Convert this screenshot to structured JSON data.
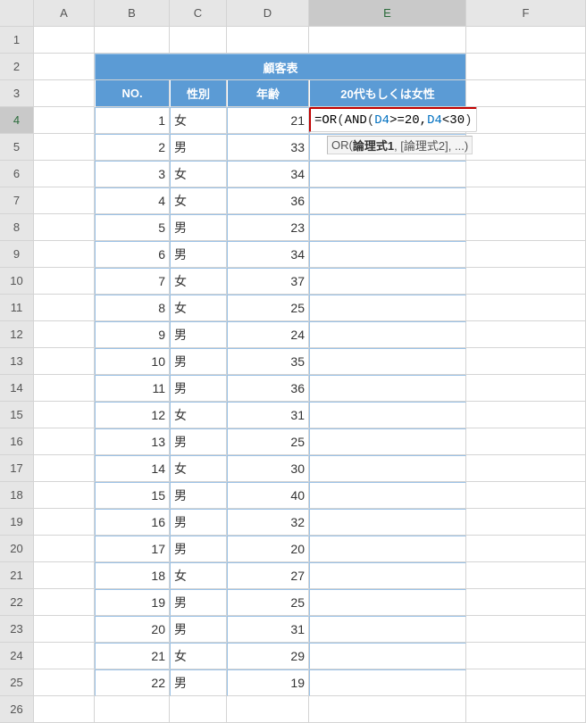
{
  "columns": [
    "A",
    "B",
    "C",
    "D",
    "E",
    "F"
  ],
  "rows": [
    1,
    2,
    3,
    4,
    5,
    6,
    7,
    8,
    9,
    10,
    11,
    12,
    13,
    14,
    15,
    16,
    17,
    18,
    19,
    20,
    21,
    22,
    23,
    24,
    25,
    26
  ],
  "activeRow": 4,
  "activeCol": "E",
  "title": "顧客表",
  "headers": {
    "no": "NO.",
    "gender": "性別",
    "age": "年齢",
    "cond": "20代もしくは女性"
  },
  "data": [
    {
      "no": 1,
      "gender": "女",
      "age": 21
    },
    {
      "no": 2,
      "gender": "男",
      "age": 33
    },
    {
      "no": 3,
      "gender": "女",
      "age": 34
    },
    {
      "no": 4,
      "gender": "女",
      "age": 36
    },
    {
      "no": 5,
      "gender": "男",
      "age": 23
    },
    {
      "no": 6,
      "gender": "男",
      "age": 34
    },
    {
      "no": 7,
      "gender": "女",
      "age": 37
    },
    {
      "no": 8,
      "gender": "女",
      "age": 25
    },
    {
      "no": 9,
      "gender": "男",
      "age": 24
    },
    {
      "no": 10,
      "gender": "男",
      "age": 35
    },
    {
      "no": 11,
      "gender": "男",
      "age": 36
    },
    {
      "no": 12,
      "gender": "女",
      "age": 31
    },
    {
      "no": 13,
      "gender": "男",
      "age": 25
    },
    {
      "no": 14,
      "gender": "女",
      "age": 30
    },
    {
      "no": 15,
      "gender": "男",
      "age": 40
    },
    {
      "no": 16,
      "gender": "男",
      "age": 32
    },
    {
      "no": 17,
      "gender": "男",
      "age": 20
    },
    {
      "no": 18,
      "gender": "女",
      "age": 27
    },
    {
      "no": 19,
      "gender": "男",
      "age": 25
    },
    {
      "no": 20,
      "gender": "男",
      "age": 31
    },
    {
      "no": 21,
      "gender": "女",
      "age": 29
    },
    {
      "no": 22,
      "gender": "男",
      "age": 19
    }
  ],
  "formula": {
    "parts": [
      {
        "t": "=OR",
        "c": "f-black"
      },
      {
        "t": "(",
        "c": "f-paren1"
      },
      {
        "t": "AND",
        "c": "f-black"
      },
      {
        "t": "(",
        "c": "f-paren1"
      },
      {
        "t": "D4",
        "c": "f-blue"
      },
      {
        "t": ">=20,",
        "c": "f-black"
      },
      {
        "t": "D4",
        "c": "f-blue"
      },
      {
        "t": "<30",
        "c": "f-black"
      },
      {
        "t": ")",
        "c": "f-paren1"
      }
    ]
  },
  "tooltip": {
    "fn": "OR(",
    "arg1": "論理式1",
    "rest": ", [論理式2], ...)"
  }
}
